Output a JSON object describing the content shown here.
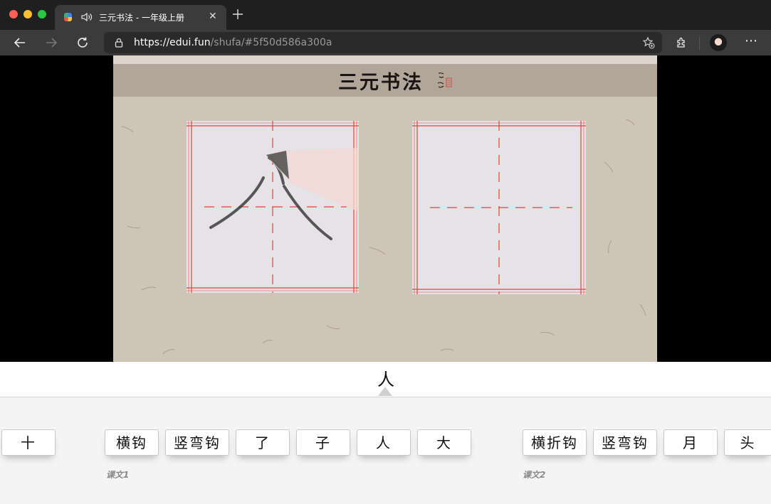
{
  "browser": {
    "tab_title": "三元书法 - 一年级上册",
    "url_host": "https://edui.fun",
    "url_path": "/shufa/#5f50d586a300a"
  },
  "video": {
    "logo_text": "三元书法",
    "seal_text": "启功"
  },
  "selector": {
    "current_char": "人",
    "items": [
      {
        "label": "十"
      },
      {
        "label": "横钩"
      },
      {
        "label": "竖弯钩"
      },
      {
        "label": "了"
      },
      {
        "label": "子"
      },
      {
        "label": "人"
      },
      {
        "label": "大"
      },
      {
        "label": "横折钩"
      },
      {
        "label": "竖弯钩"
      },
      {
        "label": "月"
      },
      {
        "label": "头"
      }
    ],
    "lessons": [
      {
        "label": "课文1"
      },
      {
        "label": "课文2"
      }
    ]
  },
  "colors": {
    "chrome_bg": "#1f1f1f",
    "toolbar_bg": "#3b3b3b",
    "paper_bg": "#cfc4b8",
    "grid_line": "#e8403a"
  }
}
